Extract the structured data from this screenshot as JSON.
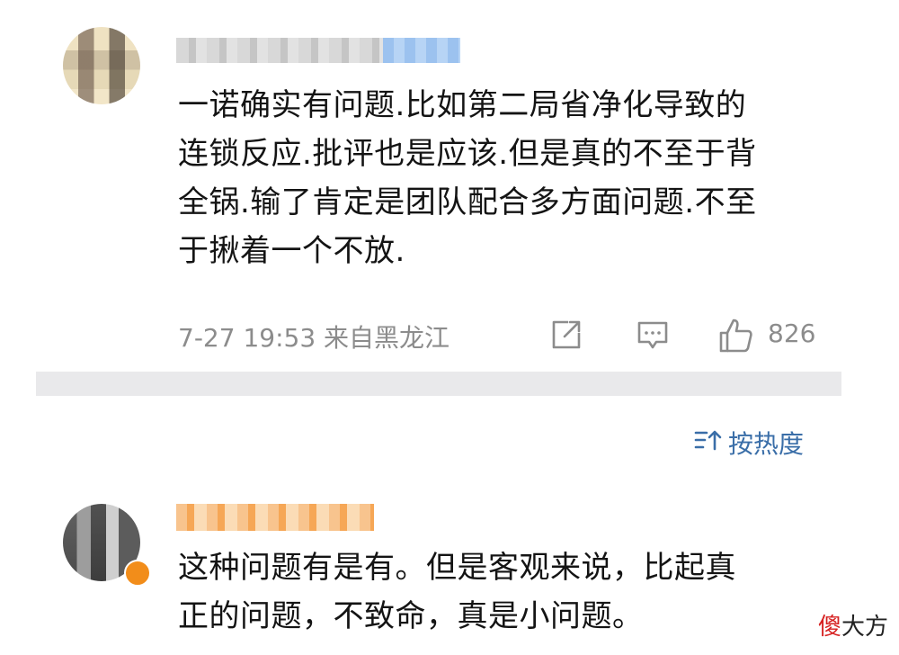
{
  "comments": [
    {
      "text_lines": [
        "一诺确实有问题.比如第二局省净化导致的",
        "连锁反应.批评也是应该.但是真的不至于背",
        "全锅.输了肯定是团队配合多方面问题.不至",
        "于揪着一个不放."
      ],
      "time_location": "7-27 19:53 来自黑龙江",
      "like_count": "826",
      "icons": [
        "share-icon",
        "comment-icon",
        "like-icon"
      ]
    },
    {
      "text_lines": [
        "这种问题有是有。但是客观来说，比起真",
        "正的问题，不致命，真是小问题。"
      ]
    }
  ],
  "sort": {
    "label": "按热度",
    "icon": "sort-icon"
  },
  "watermark": {
    "first": "傻",
    "rest": "大方"
  },
  "colors": {
    "accent": "#3a6ea8",
    "meta": "#8c8c8c",
    "text": "#141414",
    "watermark_red": "#d62020"
  }
}
